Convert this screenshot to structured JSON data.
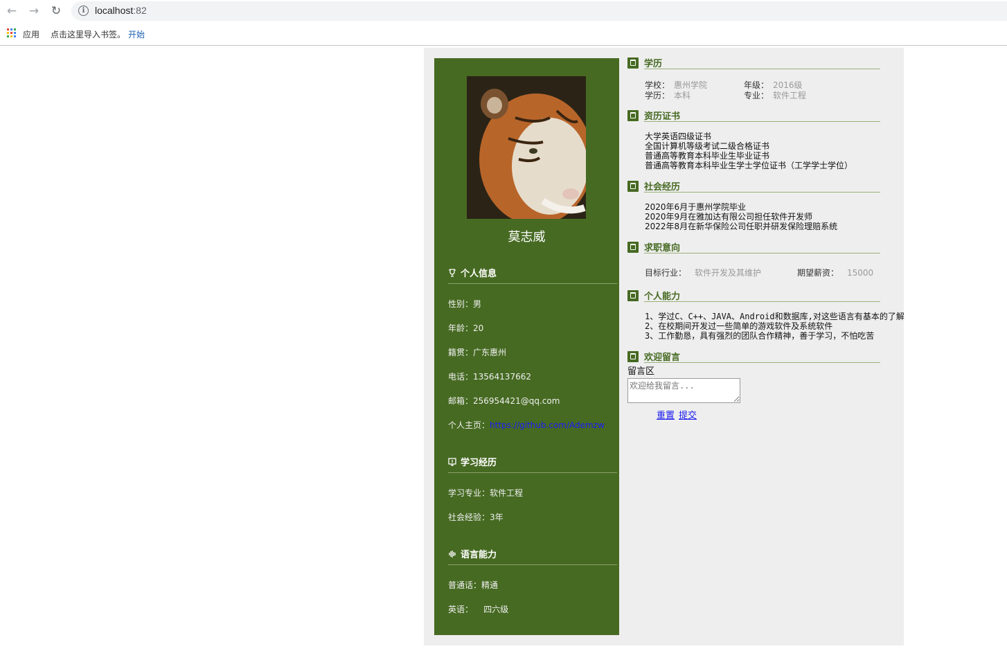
{
  "browser": {
    "url_host": "localhost",
    "url_port": ":82",
    "bookmarks": {
      "apps_label": "应用",
      "import_text": "点击这里导入书签。",
      "start_link": "开始"
    }
  },
  "profile": {
    "name": "莫志威",
    "sections": {
      "personal": {
        "title": "个人信息",
        "gender": "性别：男",
        "age": "年龄：20",
        "native_place": "籍贯：广东惠州",
        "phone": "电话：13564137662",
        "email": "邮箱：256954421@qq.com",
        "homepage_label": "个人主页：",
        "homepage_link": "https://github.com/Ademzw"
      },
      "study": {
        "title": "学习经历",
        "major": "学习专业：软件工程",
        "experience": "社会经验：3年"
      },
      "language": {
        "title": "语言能力",
        "mandarin": "普通话：精通",
        "english": "英语：    四六级"
      }
    }
  },
  "main": {
    "education": {
      "title": "学历",
      "school_label": "学校：",
      "school": "惠州学院",
      "grade_label": "年级：",
      "grade": "2016级",
      "degree_label": "学历：",
      "degree": "本科",
      "major_label": "专业：",
      "major": "软件工程"
    },
    "certificates": {
      "title": "资历证书",
      "items": [
        "大学英语四级证书",
        "全国计算机等级考试二级合格证书",
        "普通高等教育本科毕业生毕业证书",
        "普通高等教育本科毕业生学士学位证书（工学学士学位）"
      ]
    },
    "social": {
      "title": "社会经历",
      "items": [
        "2020年6月于惠州学院毕业",
        "2020年9月在雅加达有限公司担任软件开发师",
        "2022年8月在新华保险公司任职并研发保险理赔系统"
      ]
    },
    "job": {
      "title": "求职意向",
      "industry_label": "目标行业：",
      "industry": "软件开发及其维护",
      "salary_label": "期望薪资：",
      "salary": "15000"
    },
    "ability": {
      "title": "个人能力",
      "items": [
        "1、学过C、C++、JAVA、Android和数据库,对这些语言有基本的了解",
        "2、在校期间开发过一些简单的游戏软件及系统软件",
        "3、工作勤恳，具有强烈的团队合作精神，善于学习，不怕吃苦"
      ]
    },
    "message": {
      "title": "欢迎留言",
      "area_label": "留言区",
      "placeholder": "欢迎给我留言...",
      "reset": "重置",
      "submit": "提交"
    }
  },
  "colors": {
    "sidebar_bg": "#466a22",
    "page_bg": "#eeeeee",
    "accent": "#466a22"
  }
}
